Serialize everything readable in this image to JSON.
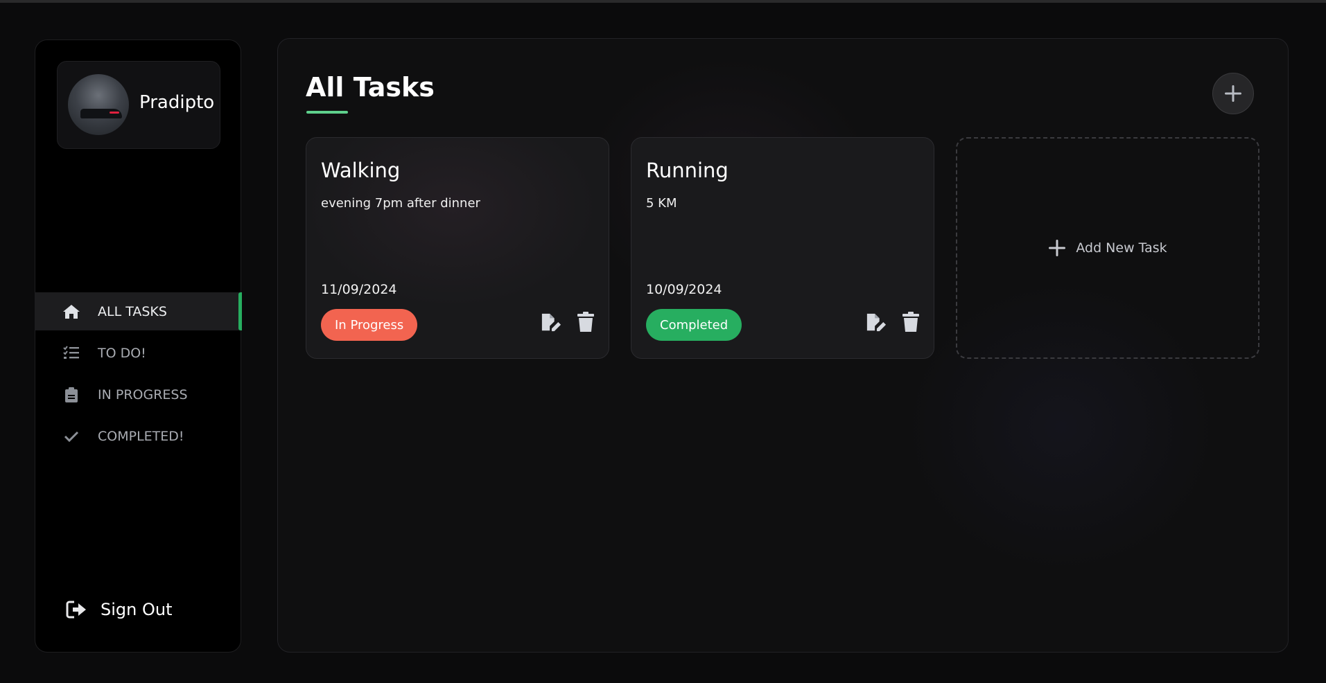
{
  "profile": {
    "name": "Pradipto"
  },
  "nav": {
    "items": [
      {
        "label": "ALL TASKS",
        "icon": "home-icon",
        "active": true
      },
      {
        "label": "TO DO!",
        "icon": "list-check-icon",
        "active": false
      },
      {
        "label": "IN PROGRESS",
        "icon": "clipboard-icon",
        "active": false
      },
      {
        "label": "COMPLETED!",
        "icon": "check-icon",
        "active": false
      }
    ],
    "signout_label": "Sign Out"
  },
  "main": {
    "title": "All Tasks",
    "add_new_label": "Add New Task"
  },
  "tasks": [
    {
      "title": "Walking",
      "description": "evening 7pm after dinner",
      "date": "11/09/2024",
      "status": "In Progress"
    },
    {
      "title": "Running",
      "description": "5 KM",
      "date": "10/09/2024",
      "status": "Completed"
    }
  ],
  "colors": {
    "accent": "#27ae60",
    "in_progress": "#f26450",
    "completed": "#27ae60"
  }
}
